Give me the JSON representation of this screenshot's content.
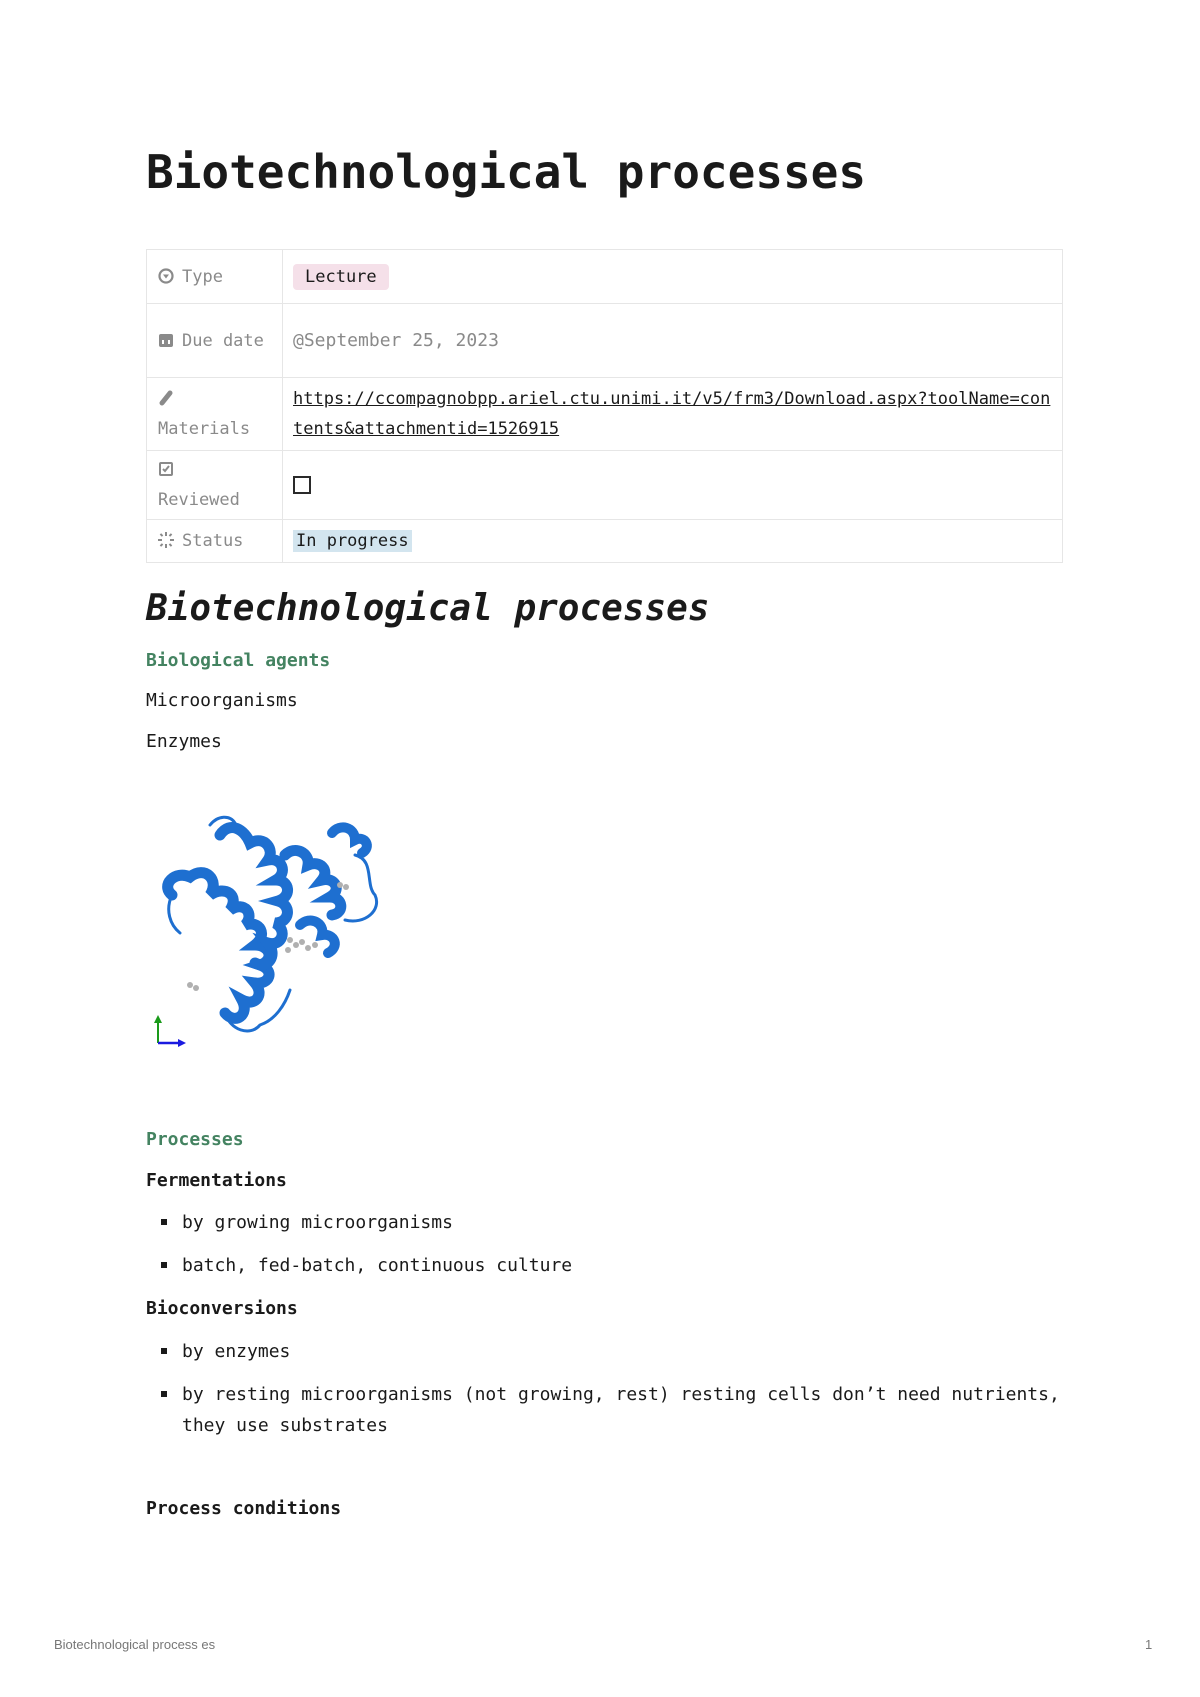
{
  "page": {
    "title": "Biotechnological processes",
    "properties": {
      "type": {
        "icon": "type-select-icon",
        "label": "Type",
        "value": "Lecture",
        "color": "#f5e0e9"
      },
      "due_date": {
        "icon": "calendar-icon",
        "label": "Due date",
        "value": "@September 25, 2023"
      },
      "materials": {
        "icon": "paperclip-icon",
        "label": "Materials",
        "value": "https://ccompagnobpp.ariel.ctu.unimi.it/v5/frm3/Download.aspx?toolName=contents&attachmentid=1526915"
      },
      "reviewed": {
        "icon": "checkbox-icon",
        "label": "Reviewed",
        "checked": false
      },
      "status": {
        "icon": "status-icon",
        "label": "Status",
        "value": "In progress",
        "color": "#d3e5ef"
      }
    }
  },
  "content": {
    "heading": "Biotechnological processes",
    "biological_agents": {
      "heading": "Biological agents",
      "items": [
        "Microorganisms",
        "Enzymes"
      ],
      "image_alt": "protein ribbon structure"
    },
    "processes": {
      "heading": "Processes",
      "fermentations": {
        "heading": "Fermentations",
        "bullets": [
          "by growing microorganisms",
          "batch, fed-batch, continuous culture"
        ]
      },
      "bioconversions": {
        "heading": "Bioconversions",
        "bullets": [
          "by enzymes",
          "by resting microorganisms (not growing, rest) resting cells don’t need nutrients, they use substrates"
        ]
      }
    },
    "process_conditions": {
      "heading": "Process conditions"
    }
  },
  "footer": {
    "doc_title": "Biotechnological process es",
    "page_number": "1"
  },
  "colors": {
    "section_heading": "#448361",
    "text": "#1a1a1a",
    "muted": "#8a8a8a",
    "protein": "#1e6fd0"
  }
}
